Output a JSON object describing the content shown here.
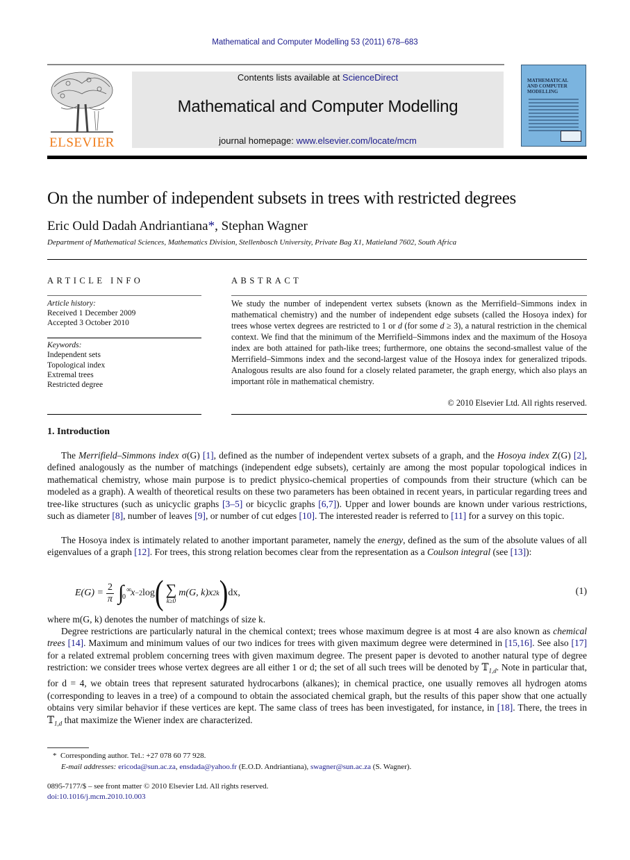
{
  "header": {
    "citation": "Mathematical and Computer Modelling 53 (2011) 678–683",
    "contents_prefix": "Contents lists available at ",
    "contents_link": "ScienceDirect",
    "journal_title": "Mathematical and Computer Modelling",
    "homepage_prefix": "journal homepage: ",
    "homepage_link": "www.elsevier.com/locate/mcm",
    "publisher_wordmark": "ELSEVIER",
    "cover_title_lines": [
      "MATHEMATICAL",
      "AND COMPUTER",
      "MODELLING"
    ],
    "colors": {
      "publisher_orange": "#f07c19",
      "link_blue": "#1a1a8c",
      "banner_gray": "#e7e7e7",
      "cover_blue": "#7bb4df"
    }
  },
  "article": {
    "title": "On the number of independent subsets in trees with restricted degrees",
    "authors": [
      {
        "name": "Eric Ould Dadah Andriantiana",
        "mark": "*"
      },
      {
        "name": "Stephan Wagner",
        "mark": ""
      }
    ],
    "author_separator": ", ",
    "affiliation": "Department of Mathematical Sciences, Mathematics Division, Stellenbosch University, Private Bag X1, Matieland 7602, South Africa"
  },
  "article_info": {
    "heading": "ARTICLE INFO",
    "history_label": "Article history:",
    "received": "Received 1 December 2009",
    "accepted": "Accepted 3 October 2010",
    "keywords_label": "Keywords:",
    "keywords": [
      "Independent sets",
      "Topological index",
      "Extremal trees",
      "Restricted degree"
    ]
  },
  "abstract": {
    "heading": "ABSTRACT",
    "text_1": "We study the number of independent vertex subsets (known as the Merrifield–Simmons index in mathematical chemistry) and the number of independent edge subsets (called the Hosoya index) for trees whose vertex degrees are restricted to 1 or ",
    "var_d": "d",
    "text_2": " (for some ",
    "text_3": " ≥ 3), a natural restriction in the chemical context. We find that the minimum of the Merrifield–Simmons index and the maximum of the Hosoya index are both attained for path-like trees; furthermore, one obtains the second-smallest value of the Merrifield–Simmons index and the second-largest value of the Hosoya index for generalized tripods. Analogous results are also found for a closely related parameter, the graph energy, which also plays an important rôle in mathematical chemistry.",
    "copyright": "© 2010 Elsevier Ltd. All rights reserved."
  },
  "section_1": {
    "heading": "1.  Introduction",
    "p1": {
      "a": "The ",
      "ms_index": "Merrifield–Simmons index",
      "b": " σ(G) ",
      "ref1": "[1]",
      "c": ", defined as the number of independent vertex subsets of a graph, and the ",
      "hosoya_index": "Hosoya index",
      "d": " Z(G) ",
      "ref2": "[2]",
      "e": ", defined analogously as the number of matchings (independent edge subsets), certainly are among the most popular topological indices in mathematical chemistry, whose main purpose is to predict physico-chemical properties of compounds from their structure (which can be modeled as a graph). A wealth of theoretical results on these two parameters has been obtained in recent years, in particular regarding trees and tree-like structures (such as unicyclic graphs ",
      "ref3": "[3–5]",
      "f": " or bicyclic graphs ",
      "ref4": "[6,7]",
      "g": "). Upper and lower bounds are known under various restrictions, such as diameter ",
      "ref5": "[8]",
      "h": ", number of leaves ",
      "ref6": "[9]",
      "i": ", or number of cut edges ",
      "ref7": "[10]",
      "j": ". The interested reader is referred to ",
      "ref8": "[11]",
      "k": " for a survey on this topic."
    },
    "p2": {
      "a": "The Hosoya index is intimately related to another important parameter, namely the ",
      "energy": "energy",
      "b": ", defined as the sum of the absolute values of all eigenvalues of a graph ",
      "ref1": "[12]",
      "c": ". For trees, this strong relation becomes clear from the representation as a ",
      "coulson": "Coulson integral",
      "d": " (see ",
      "ref2": "[13]",
      "e": "):"
    },
    "equation": {
      "lhs": "E(G) = ",
      "frac_num": "2",
      "frac_den": "π",
      "int_upper": "∞",
      "int_lower": "0",
      "integrand": "x",
      "exp": "−2",
      "log": " log",
      "sum_lower": "k≥0",
      "term": "m(G, k)x",
      "term_exp": "2k",
      "dx": " dx,",
      "number": "(1)"
    },
    "p3": "where m(G, k) denotes the number of matchings of size k.",
    "p4": {
      "a": "Degree restrictions are particularly natural in the chemical context; trees whose maximum degree is at most 4 are also known as ",
      "chem_trees": "chemical trees",
      "b": " ",
      "ref1": "[14]",
      "c": ". Maximum and minimum values of our two indices for trees with given maximum degree were determined in ",
      "ref2": "[15,16]",
      "d": ". See also ",
      "ref3": "[17]",
      "e": " for a related extremal problem concerning trees with given maximum degree. The present paper is devoted to another natural type of degree restriction: we consider trees whose vertex degrees are all either 1 or d; the set of all such trees will be denoted by 𝕋",
      "sub1": "1,d",
      "f": ". Note in particular that, for d = 4, we obtain trees that represent saturated hydrocarbons (alkanes); in chemical practice, one usually removes all hydrogen atoms (corresponding to leaves in a tree) of a compound to obtain the associated chemical graph, but the results of this paper show that one actually obtains very similar behavior if these vertices are kept. The same class of trees has been investigated, for instance, in ",
      "ref4": "[18]",
      "g": ". There, the trees in 𝕋",
      "sub2": "1,d",
      "h": " that maximize the Wiener index are characterized."
    }
  },
  "footnotes": {
    "star": "*",
    "corresponding": "Corresponding author. Tel.: +27 078 60 77 928.",
    "email_label": "E-mail addresses: ",
    "email_1": "ericoda@sun.ac.za",
    "sep_1": ", ",
    "email_2": "ensdada@yahoo.fr",
    "owner_1": " (E.O.D. Andriantiana), ",
    "email_3": "swagner@sun.ac.za",
    "owner_2": " (S. Wagner).",
    "issn_line": "0895-7177/$ – see front matter © 2010 Elsevier Ltd. All rights reserved.",
    "doi": "doi:10.1016/j.mcm.2010.10.003"
  }
}
